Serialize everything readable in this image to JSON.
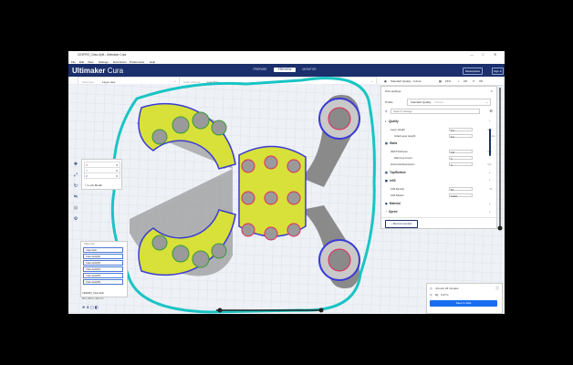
{
  "window": {
    "title": "CE3PRO_Claw-Split - Ultimaker Cura",
    "controls": [
      "—",
      "□",
      "✕"
    ]
  },
  "menu": [
    "File",
    "Edit",
    "View",
    "Settings",
    "Extensions",
    "Preferences",
    "Help"
  ],
  "header": {
    "logo_main": "Ultimaker",
    "logo_sub": "Cura",
    "stages": [
      "PREPARE",
      "PREVIEW",
      "MONITOR"
    ],
    "active_stage": "PREVIEW",
    "marketplace": "Marketplace",
    "signin": "Sign in"
  },
  "viewbar": {
    "view_type_label": "View type",
    "view_type_value": "Layer view",
    "color_scheme_label": "Color scheme",
    "color_scheme_value": "Line Type"
  },
  "profilebar": {
    "quality": "Standard Quality - 0.2mm",
    "infill": "15%",
    "support": "Off",
    "adhesion": "Off"
  },
  "layer_box": {
    "rows": [
      {
        "axis": "X",
        "value": "0"
      },
      {
        "axis": "Y",
        "value": "0"
      },
      {
        "axis": "Z",
        "value": "0"
      }
    ],
    "lock_label": "Lock Model"
  },
  "objects": {
    "header": "Object list",
    "items": [
      "Claw-Split",
      "Claw-Split(#2)",
      "Claw-Split(#3)",
      "Claw-Split(#4)",
      "Claw-Split(#5)",
      "Claw-Split(#6)"
    ],
    "footer": "CE3PRO_Claw-Split",
    "dims": "96.2 x 80.2 x 10.0 mm"
  },
  "print_settings": {
    "title": "Print settings",
    "profile_label": "Profile",
    "profile_value": "Standard Quality",
    "profile_suffix": "- 0.2mm",
    "search_placeholder": "Search settings",
    "sections": {
      "quality": "Quality",
      "walls": "Walls",
      "top_bottom": "Top/Bottom",
      "infill": "Infill",
      "material": "Material",
      "speed": "Speed"
    },
    "rows": {
      "layer_height": {
        "label": "Layer Height",
        "value": "0.2",
        "unit": "mm"
      },
      "initial_layer_height": {
        "label": "Initial Layer Height",
        "value": "0.2",
        "unit": "mm"
      },
      "wall_thickness": {
        "label": "Wall Thickness",
        "value": "0.8",
        "unit": "mm"
      },
      "wall_line_count": {
        "label": "Wall Line Count",
        "value": "2",
        "unit": ""
      },
      "horizontal_expansion": {
        "label": "Horizontal Expansion",
        "value": "0",
        "unit": "mm"
      },
      "infill_density": {
        "label": "Infill Density",
        "value": "15",
        "unit": "%"
      },
      "infill_pattern": {
        "label": "Infill Pattern",
        "value": "Cubic",
        "unit": ""
      }
    },
    "recommended": "Recommended"
  },
  "estimate": {
    "time": "4 hours 24 minutes",
    "material": "8g · 3.27m",
    "save": "Save to Disk"
  },
  "colors": {
    "header": "#1a2f6b",
    "accent": "#196ef0",
    "teal": "#19c4c4",
    "wall_outer": "#e02a5a",
    "wall_inner": "#3a9a3a",
    "infill": "#d8e03a",
    "travel": "#3b3bd6"
  }
}
